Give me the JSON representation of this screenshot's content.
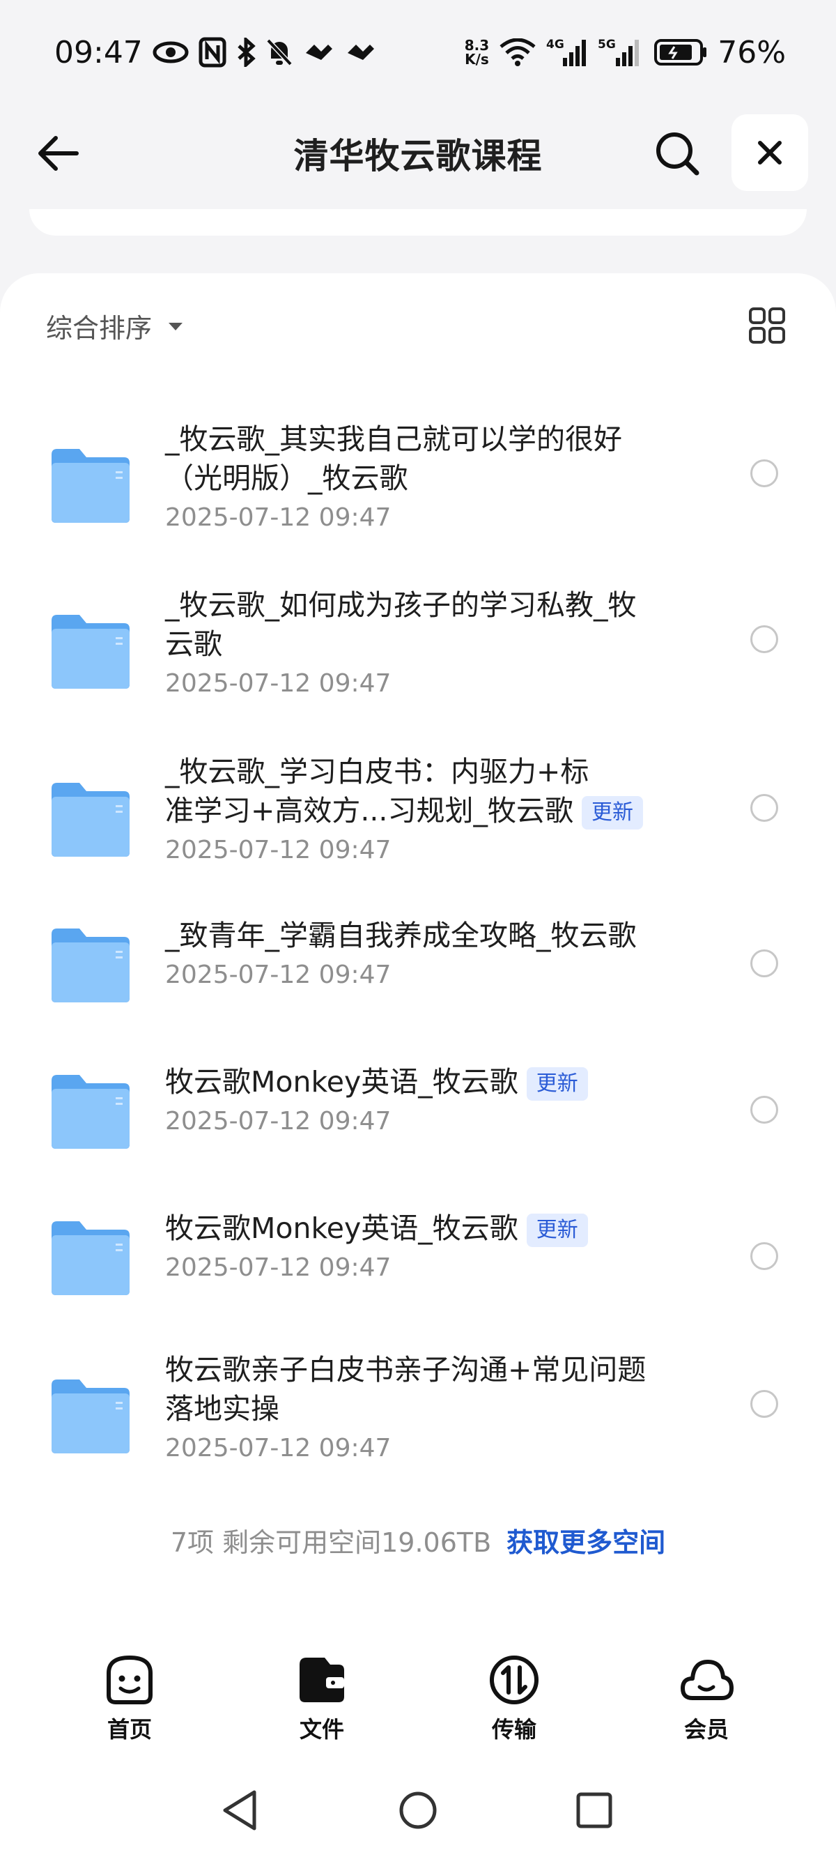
{
  "status_bar": {
    "time": "09:47",
    "net_speed_value": "8.3",
    "net_speed_unit": "K/s",
    "signal1_label": "4G",
    "signal2_label": "5G",
    "battery": "76%"
  },
  "header": {
    "title": "清华牧云歌课程"
  },
  "sort": {
    "label": "综合排序"
  },
  "files": [
    {
      "name_line1": "_牧云歌_其实我自己就可以学的很好",
      "name_line2": "（光明版）_牧云歌",
      "badge": "",
      "date": "2025-07-12 09:47"
    },
    {
      "name_line1": "_牧云歌_如何成为孩子的学习私教_牧",
      "name_line2": "云歌",
      "badge": "",
      "date": "2025-07-12 09:47"
    },
    {
      "name_line1": "_牧云歌_学习白皮书：内驱力+标",
      "name_line2": "准学习+高效方...习规划_牧云歌",
      "badge": "更新",
      "date": "2025-07-12 09:47"
    },
    {
      "name_line1": "_致青年_学霸自我养成全攻略_牧云歌",
      "name_line2": "",
      "badge": "",
      "date": "2025-07-12 09:47"
    },
    {
      "name_line1": "牧云歌Monkey英语_牧云歌",
      "name_line2": "",
      "badge": "更新",
      "date": "2025-07-12 09:47"
    },
    {
      "name_line1": "牧云歌Monkey英语_牧云歌",
      "name_line2": "",
      "badge": "更新",
      "date": "2025-07-12 09:47"
    },
    {
      "name_line1": "牧云歌亲子白皮书亲子沟通+常见问题",
      "name_line2": "落地实操",
      "badge": "",
      "date": "2025-07-12 09:47"
    }
  ],
  "footer": {
    "summary": "7项 剩余可用空间19.06TB",
    "link": "获取更多空间"
  },
  "bottom_nav": [
    {
      "label": "首页",
      "icon": "smiley-icon"
    },
    {
      "label": "文件",
      "icon": "wallet-folder-icon"
    },
    {
      "label": "传输",
      "icon": "transfer-icon"
    },
    {
      "label": "会员",
      "icon": "cloud-icon"
    }
  ],
  "colors": {
    "accent": "#1f5ad0",
    "folder": "#6fb3f5",
    "badge_bg": "#e3ecff",
    "badge_text": "#2a5bd6"
  }
}
